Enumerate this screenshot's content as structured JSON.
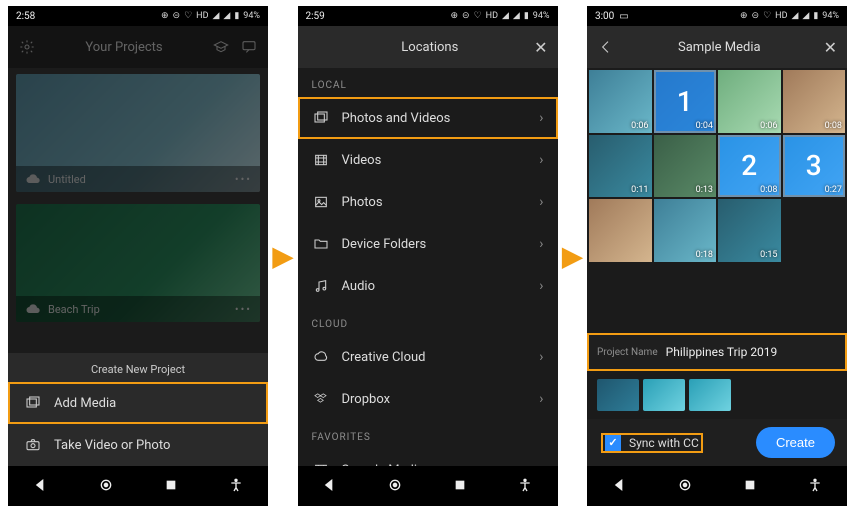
{
  "status": {
    "time1": "2:58",
    "time2": "2:59",
    "time3": "3:00",
    "hd": "HD",
    "battery": "94%",
    "heart": "♡"
  },
  "s1": {
    "title": "Your Projects",
    "proj1": {
      "name": "Untitled"
    },
    "proj2": {
      "name": "Beach Trip"
    },
    "create_title": "Create New Project",
    "add_media": "Add Media",
    "take": "Take Video or Photo"
  },
  "s2": {
    "title": "Locations",
    "sec_local": "LOCAL",
    "sec_cloud": "CLOUD",
    "sec_fav": "FAVORITES",
    "items": {
      "pv": "Photos and Videos",
      "videos": "Videos",
      "photos": "Photos",
      "devfolders": "Device Folders",
      "audio": "Audio",
      "cc": "Creative Cloud",
      "dropbox": "Dropbox",
      "sample": "Sample Media"
    }
  },
  "s3": {
    "title": "Sample Media",
    "durations": [
      "0:06",
      "0:04",
      "0:06",
      "0:08",
      "0:11",
      "0:13",
      "0:08",
      "0:27",
      "",
      "0:18",
      "0:15"
    ],
    "selected_nums": [
      "1",
      "2",
      "3"
    ],
    "project_name_label": "Project Name",
    "project_name_value": "Philippines Trip 2019",
    "sync": "Sync with CC",
    "create": "Create"
  }
}
